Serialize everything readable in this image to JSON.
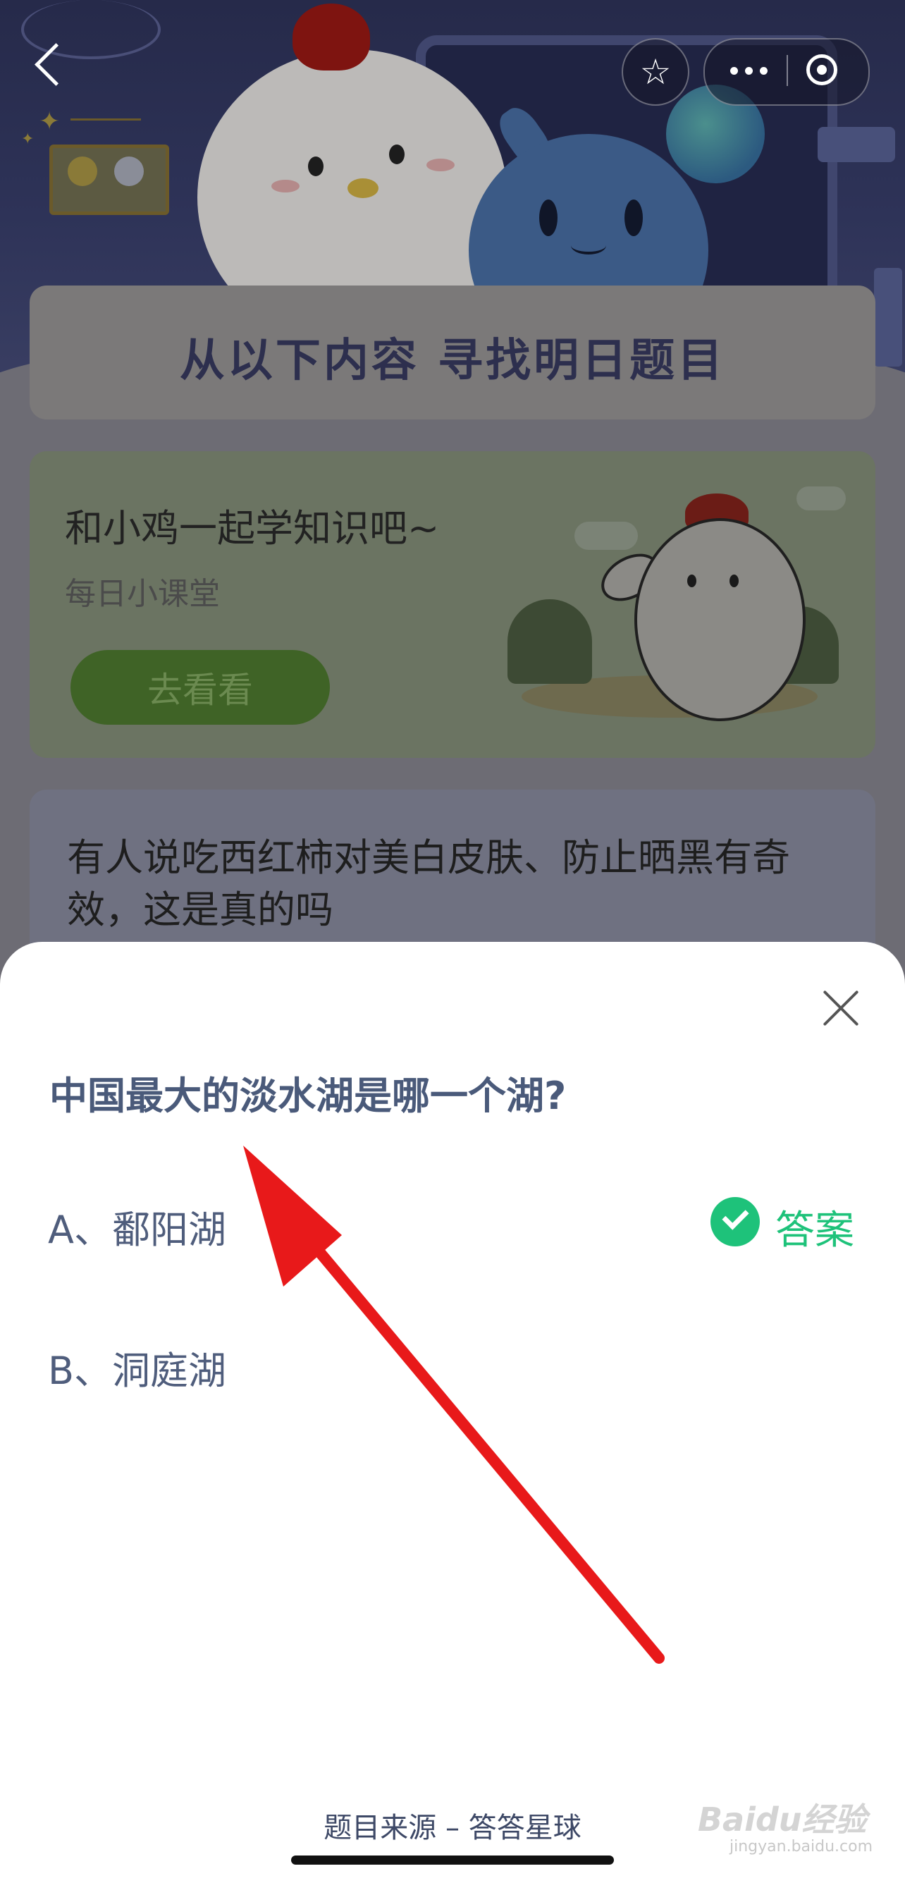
{
  "header": {
    "title": "从以下内容 寻找明日题目"
  },
  "lesson_card": {
    "title": "和小鸡一起学知识吧~",
    "subtitle": "每日小课堂",
    "button_label": "去看看"
  },
  "question_card": {
    "text": "有人说吃西红柿对美白皮肤、防止晒黑有奇效，这是真的吗"
  },
  "sheet": {
    "question": "中国最大的淡水湖是哪一个湖?",
    "options": [
      {
        "label": "A、鄱阳湖",
        "is_answer": true
      },
      {
        "label": "B、洞庭湖",
        "is_answer": false
      }
    ],
    "answer_label": "答案",
    "source": "题目来源 – 答答星球"
  },
  "watermark": {
    "brand": "Baidu经验",
    "url": "jingyan.baidu.com"
  },
  "icons": {
    "back": "chevron-left-icon",
    "favorite": "star-icon",
    "more": "more-dots-icon",
    "target": "target-icon",
    "close": "close-icon",
    "answer": "check-circle-icon"
  },
  "colors": {
    "answer_green": "#1ec27a",
    "question_text": "#4a5a7a",
    "annotation_arrow": "#e8191a"
  }
}
